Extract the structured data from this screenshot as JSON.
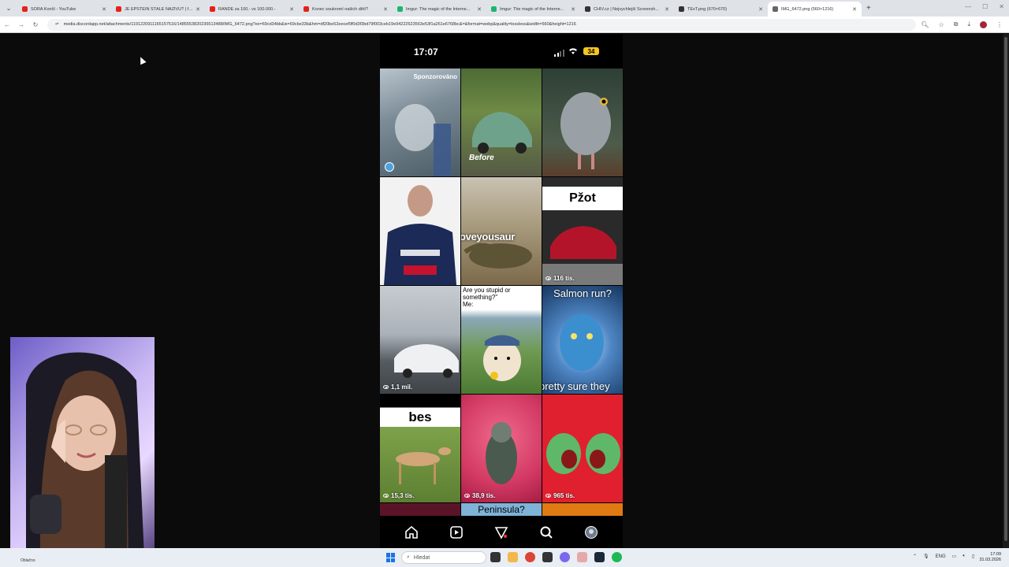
{
  "browser": {
    "tabs": [
      {
        "title": "SORA Konší - YouTube",
        "fav_color": "#e62117",
        "active": false
      },
      {
        "title": "JE EPSTEIN STÁLE NAŽIVU? | fo...",
        "fav_color": "#e62117",
        "active": false
      },
      {
        "title": "RANDE za 100.- vs 100.000.-",
        "fav_color": "#e62117",
        "active": false
      },
      {
        "title": "Konec soukromí našich dětí?",
        "fav_color": "#e62117",
        "active": false
      },
      {
        "title": "Imgur: The magic of the Interne...",
        "fav_color": "#1bb76e",
        "active": false
      },
      {
        "title": "Imgur: The magic of the Interne...",
        "fav_color": "#1bb76e",
        "active": false
      },
      {
        "title": "CHIV.cz | Nejvychlejší Screensh...",
        "fav_color": "#333333",
        "active": false
      },
      {
        "title": "TExT.png (670×670)",
        "fav_color": "#333333",
        "active": false
      },
      {
        "title": "IMG_6472.png (560×1216)",
        "fav_color": "#666666",
        "active": true
      }
    ],
    "url": "media.discordapp.net/attachments/1191220911165157516/1485553820236513488/IMG_6472.png?ex=69cd34bb&is=69cbe33b&hm=df20be52eecef9f0d3f3bd79f003ceb19e94222623563e53f1a261e6768bc&=&format=webp&quality=lossless&width=560&height=1216"
  },
  "phone": {
    "time": "17:07",
    "battery": "34",
    "tiles": [
      {
        "id": "sponsored",
        "label": "Sponzorováno",
        "views": "",
        "bg": "#8b9aa5"
      },
      {
        "id": "car-before",
        "label": "Before",
        "views": "",
        "bg": "#5a6b3c"
      },
      {
        "id": "bird",
        "label": "",
        "views": "",
        "bg": "#3a4a3e"
      },
      {
        "id": "racer",
        "label": "",
        "views": "",
        "bg": "#1d3a6a"
      },
      {
        "id": "dinosaur",
        "label": "oveyousaur",
        "views": "",
        "bg": "#8f7b5a"
      },
      {
        "id": "pzot",
        "label": "Pžot",
        "views": "116 tis.",
        "bg": "#444444"
      },
      {
        "id": "white-car",
        "label": "",
        "views": "1,1 mil.",
        "bg": "#9aa2ab"
      },
      {
        "id": "dog",
        "label": "Are you stupid or something?\"\nMe:",
        "views": "",
        "bg": "#6d8c4c"
      },
      {
        "id": "avatar",
        "label": "Salmon run?",
        "label2": "pretty sure they",
        "views": "",
        "bg": "#2d5f9a"
      },
      {
        "id": "bes",
        "label": "bes",
        "views": "15,3 tis.",
        "bg": "#6b8c3e"
      },
      {
        "id": "pigeon",
        "label": "",
        "views": "38,9 tis.",
        "bg": "#d14567"
      },
      {
        "id": "frogs",
        "label": "",
        "views": "965 tis.",
        "bg": "#e0202e"
      }
    ],
    "partial_label": "Peninsula?"
  },
  "taskbar": {
    "search_placeholder": "Hledat",
    "left_text": "Oblačno",
    "lang": "ENG",
    "clock_time": "17:09",
    "clock_date": "31.03.2026"
  }
}
